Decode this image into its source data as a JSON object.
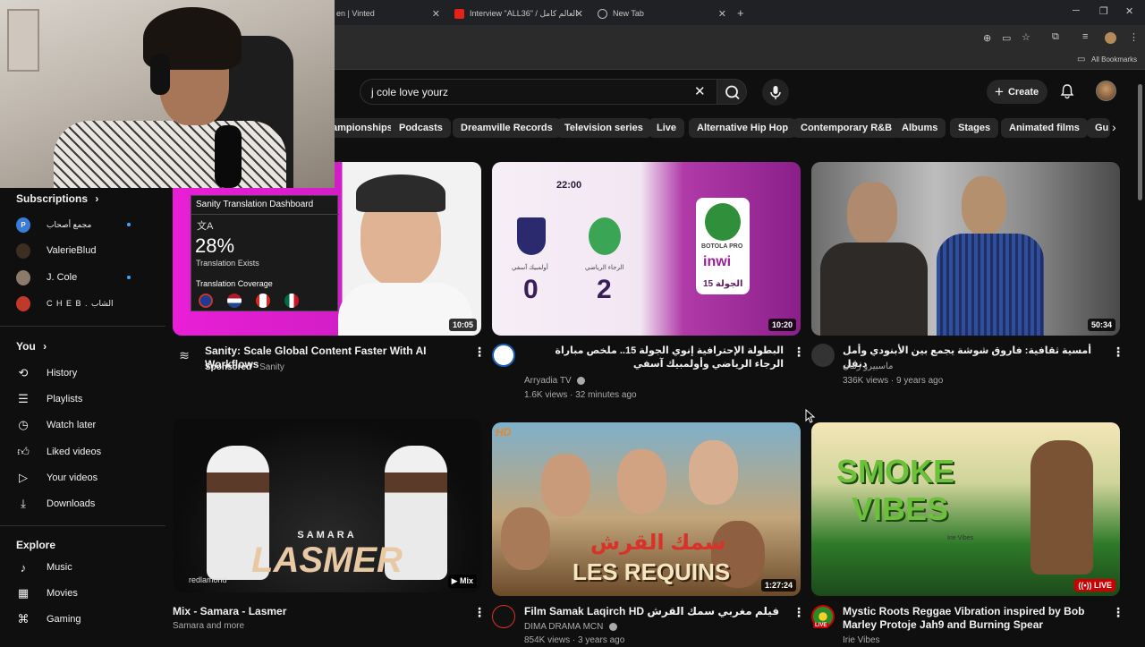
{
  "browser": {
    "tabs": [
      {
        "label": "en | Vinted"
      },
      {
        "label": "Interview \"ALL36\" / العالم كامل"
      },
      {
        "label": "New Tab"
      }
    ],
    "bookmarks_label": "All Bookmarks"
  },
  "header": {
    "search_value": "j cole love yourz",
    "create_label": "Create"
  },
  "chips": [
    "ampionships",
    "Podcasts",
    "Dreamville Records",
    "Television series",
    "Live",
    "Alternative Hip Hop",
    "Contemporary R&B",
    "Albums",
    "Stages",
    "Animated films",
    "Gu"
  ],
  "sidebar": {
    "subscriptions_heading": "Subscriptions",
    "subscriptions": [
      {
        "label": "مجمع أصحاب",
        "avatar_color": "#3b7bd8",
        "avatar_letter": "P"
      },
      {
        "label": "ValerieBlud",
        "avatar_color": "#5a4636"
      },
      {
        "label": "J. Cole",
        "avatar_color": "#8c7a6a"
      },
      {
        "label": "C H E B . الشاب",
        "avatar_color": "#c0392b"
      }
    ],
    "you_heading": "You",
    "you_items": [
      {
        "label": "History",
        "icon": "history-icon"
      },
      {
        "label": "Playlists",
        "icon": "playlists-icon"
      },
      {
        "label": "Watch later",
        "icon": "watch-later-icon"
      },
      {
        "label": "Liked videos",
        "icon": "liked-icon"
      },
      {
        "label": "Your videos",
        "icon": "your-videos-icon"
      },
      {
        "label": "Downloads",
        "icon": "downloads-icon"
      }
    ],
    "explore_heading": "Explore",
    "explore_items": [
      {
        "label": "Music",
        "icon": "music-icon"
      },
      {
        "label": "Movies",
        "icon": "movies-icon"
      },
      {
        "label": "Gaming",
        "icon": "gaming-icon"
      }
    ]
  },
  "videos": [
    {
      "title": "Sanity: Scale Global Content Faster With AI Workflows",
      "sponsored": "Sponsored",
      "channel": "Sanity",
      "duration": "10:05",
      "thumb_overlay": {
        "panel_title": "Sanity Translation Dashboard",
        "percent": "28%",
        "percent_label": "Translation Exists",
        "coverage_label": "Translation Coverage"
      }
    },
    {
      "title": "البطولة الإحترافية إنوي الجولة 15.. ملخص مباراة الرجاء الرياضي وأولمبيك آسفي",
      "channel": "Arryadia TV",
      "views": "1.6K views · 32 minutes ago",
      "duration": "10:20",
      "thumb_overlay": {
        "time": "22:00",
        "score_left": "0",
        "score_right": "2",
        "team_left": "أولمبيك آسفي",
        "team_right": "الرجاء الرياضي",
        "brand": "inwi",
        "round": "الجولة 15",
        "league": "BOTOLA PRO"
      }
    },
    {
      "title": "أمسية ثقافية: فاروق شوشة يجمع بين الأبنودي وأمل دنقل",
      "channel": "ماسبيرو زمان",
      "views": "336K views · 9 years ago",
      "duration": "50:34"
    },
    {
      "title": "Mix - Samara - Lasmer",
      "channel": "Samara and more",
      "duration": "Mix",
      "thumb_overlay": {
        "artist": "SAMARA",
        "song": "LASMER",
        "label": "redlamond"
      }
    },
    {
      "title": "Film Samak Laqirch HD فيلم مغربي سمك القرش",
      "channel": "DIMA DRAMA MCN",
      "views": "854K views · 3 years ago",
      "duration": "1:27:24",
      "thumb_overlay": {
        "hd": "HD",
        "title_ar": "سمك القرش",
        "title_fr": "LES REQUINS"
      }
    },
    {
      "title": "Mystic Roots Reggae Vibration inspired by Bob Marley Protoje Jah9 and Burning Spear",
      "channel": "Irie Vibes",
      "duration": "LIVE",
      "thumb_overlay": {
        "line1": "SMOKE",
        "line2": "VIBES",
        "brand": "Irie Vibes"
      }
    }
  ]
}
